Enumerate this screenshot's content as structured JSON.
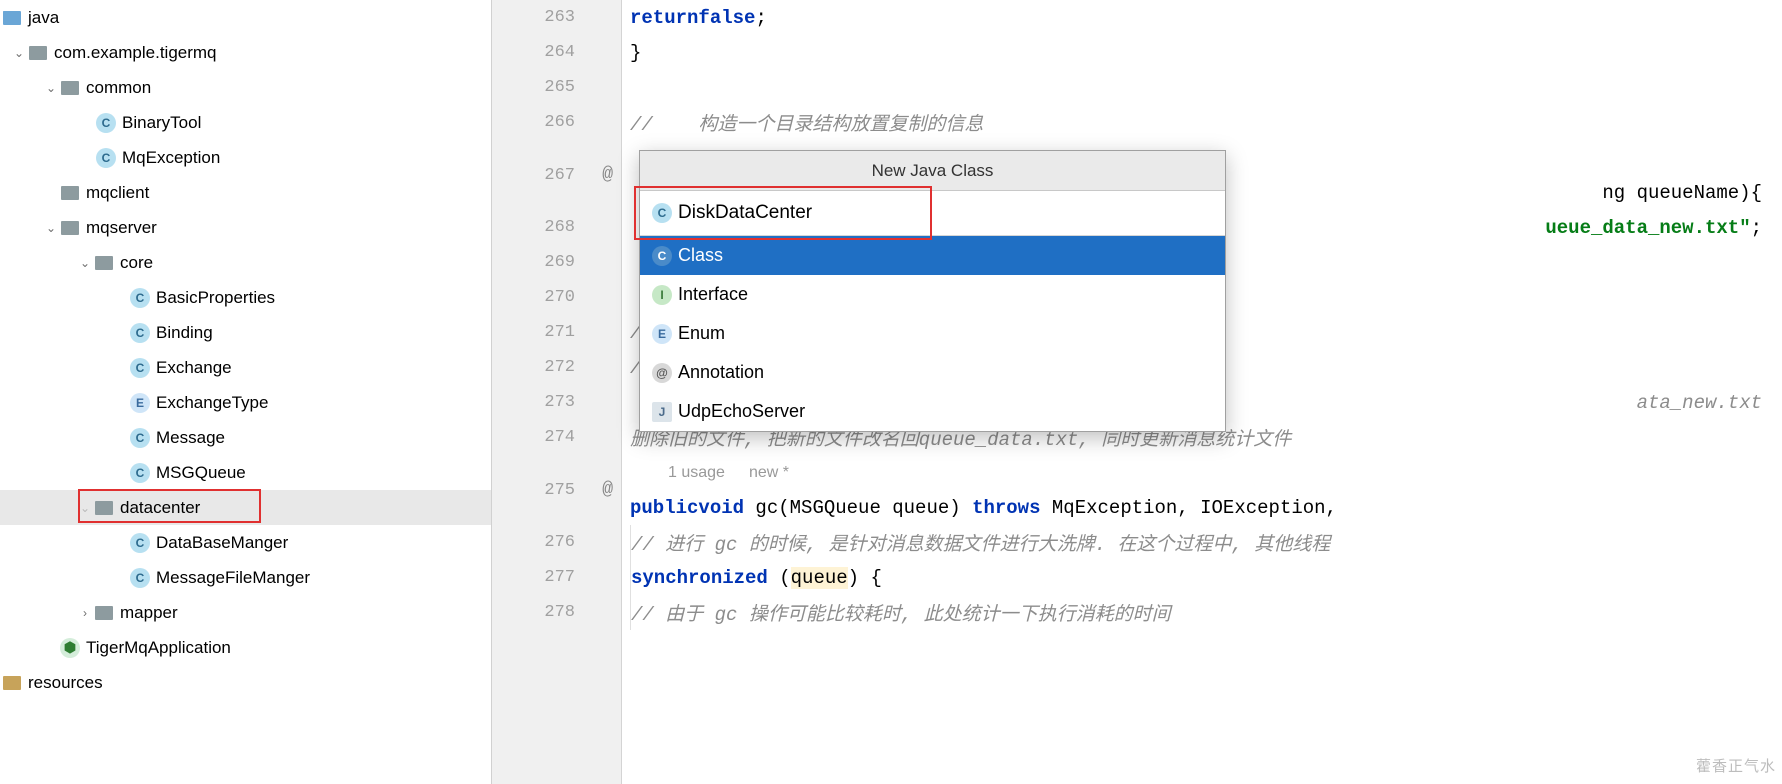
{
  "tree": {
    "java": "java",
    "pkg_root": "com.example.tigermq",
    "common": "common",
    "BinaryTool": "BinaryTool",
    "MqException": "MqException",
    "mqclient": "mqclient",
    "mqserver": "mqserver",
    "core": "core",
    "BasicProperties": "BasicProperties",
    "Binding": "Binding",
    "Exchange": "Exchange",
    "ExchangeType": "ExchangeType",
    "Message": "Message",
    "MSGQueue": "MSGQueue",
    "datacenter": "datacenter",
    "DataBaseManger": "DataBaseManger",
    "MessageFileManger": "MessageFileManger",
    "mapper": "mapper",
    "TigerMqApplication": "TigerMqApplication",
    "resources": "resources"
  },
  "gutter": {
    "l263": "263",
    "l264": "264",
    "l265": "265",
    "l266": "266",
    "l267": "267",
    "l268": "268",
    "l269": "269",
    "l270": "270",
    "l271": "271",
    "l272": "272",
    "l273": "273",
    "l274": "274",
    "l275": "275",
    "l276": "276",
    "l277": "277",
    "l278": "278",
    "at267": "@",
    "at275": "@"
  },
  "code": {
    "l263_kw1": "return",
    "l263_kw2": "false",
    "l263_tail": ";",
    "l264": "}",
    "l266_cmt": "//    构造一个目录结构放置复制的信息",
    "l267_tail": "ng queueName){",
    "l268_str": "ueue_data_new.txt\"",
    "l268_tail": ";",
    "l271_cmt": "// ",
    "l272_cmt": "// ",
    "l273_cmt": "ata_new.txt",
    "l274_cmt": "删除旧的文件, 把新的文件改名回queue_data.txt, 同时更新消息统计文件",
    "usages": "1 usage",
    "new": "new *",
    "l275_kw1": "public",
    "l275_kw2": "void",
    "l275_kw3": "throws",
    "l275_mid1": " gc(MSGQueue queue) ",
    "l275_mid2": " MqException, IOException,",
    "l276_cmt": "// 进行 gc 的时候, 是针对消息数据文件进行大洗牌. 在这个过程中, 其他线程",
    "l277_kw": "synchronized",
    "l277_var": "queue",
    "l277_p1": " (",
    "l277_p2": ") {",
    "l278_cmt": "// 由于 gc 操作可能比较耗时, 此处统计一下执行消耗的时间"
  },
  "popup": {
    "title": "New Java Class",
    "input_value": "DiskDataCenter",
    "opt_class": "Class",
    "opt_interface": "Interface",
    "opt_enum": "Enum",
    "opt_annotation": "Annotation",
    "opt_udp": "UdpEchoServer"
  },
  "icons": {
    "C": "C",
    "I": "I",
    "E": "E",
    "at": "@",
    "J": "J"
  },
  "watermark": "藿香正气水"
}
